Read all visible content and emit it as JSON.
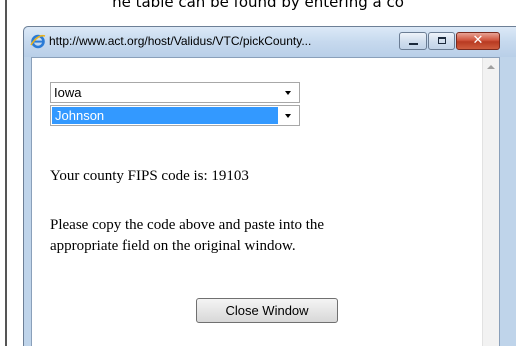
{
  "caption_text": "he table can be found by entering a co",
  "window": {
    "title": "http://www.act.org/host/Validus/VTC/pickCounty...",
    "icon": "internet-explorer-icon"
  },
  "controls": {
    "minimize_icon": "minimize-icon",
    "maximize_icon": "maximize-icon",
    "close_icon": "close-icon"
  },
  "form": {
    "state_select": {
      "selected": "Iowa"
    },
    "county_select": {
      "selected": "Johnson"
    }
  },
  "result": {
    "fips_message": "Your county FIPS code is: 19103"
  },
  "instructions": {
    "line1": "Please copy the code above and paste into the",
    "line2": "appropriate field on the original window."
  },
  "close_button": {
    "label": "Close Window"
  },
  "colors": {
    "highlight": "#3399ff",
    "close_control": "#c8452c",
    "titlebar": "#c6d9ee"
  }
}
